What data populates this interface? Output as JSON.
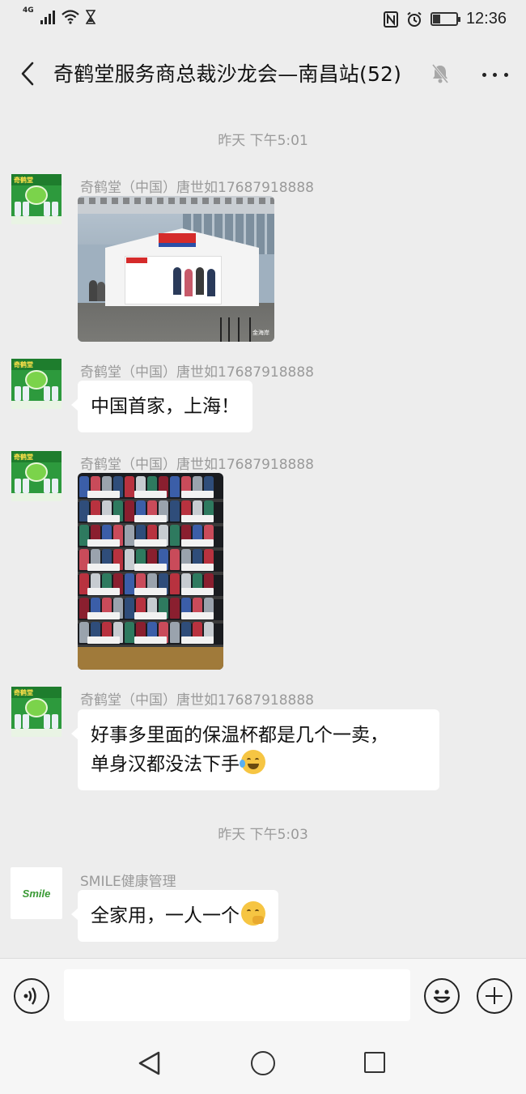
{
  "status_bar": {
    "network": "4G",
    "time": "12:36",
    "nfc_label": "N"
  },
  "header": {
    "title": "奇鹤堂服务商总裁沙龙会—南昌站(52)"
  },
  "timestamps": [
    "昨天 下午5:01",
    "昨天 下午5:03"
  ],
  "messages": [
    {
      "sender": "奇鹤堂（中国）唐世如17687918888",
      "type": "image",
      "image_desc": "costco-tent-photo",
      "watermark": "金海岸"
    },
    {
      "sender": "奇鹤堂（中国）唐世如17687918888",
      "type": "text",
      "text": "中国首家，上海！"
    },
    {
      "sender": "奇鹤堂（中国）唐世如17687918888",
      "type": "image",
      "image_desc": "contigo-bottles-photo"
    },
    {
      "sender": "奇鹤堂（中国）唐世如17687918888",
      "type": "text",
      "text_line1": "好事多里面的保温杯都是几个一卖，",
      "text_line2": "单身汉都没法下手",
      "emoji": "laugh-cry-emoji"
    },
    {
      "sender": "SMILE健康管理",
      "type": "text",
      "text": "全家用，一人一个",
      "emoji": "thinking-emoji"
    }
  ],
  "avatars": {
    "qihetang_banner": "奇鹤堂",
    "smile_logo": "Smile"
  },
  "input_bar": {
    "value": "",
    "placeholder": ""
  },
  "colors": {
    "background": "#ededed",
    "bubble": "#ffffff",
    "meta_text": "#9a9a9a",
    "brand_green": "#2d9a3d"
  }
}
